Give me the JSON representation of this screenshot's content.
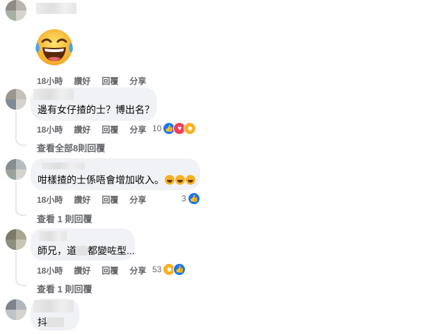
{
  "comments": [
    {
      "sticker": "haha-emoji",
      "actions": {
        "time": "18小時",
        "like": "讚好",
        "reply": "回覆",
        "share": "分享"
      }
    },
    {
      "text": "邊有女仔揸的士？博出名？",
      "actions": {
        "time": "18小時",
        "like": "讚好",
        "reply": "回覆",
        "share": "分享"
      },
      "reactions": {
        "count": "10",
        "icons": [
          "like-icon",
          "love-icon",
          "haha-icon"
        ]
      },
      "more_replies": "查看全部8則回覆"
    },
    {
      "text": "咁樣揸的士係唔會增加收入。",
      "actions": {
        "time": "18小時",
        "like": "讚好",
        "reply": "回覆",
        "share": "分享"
      },
      "reactions": {
        "count": "3",
        "icons": [
          "like-icon"
        ]
      },
      "more_replies": "查看 1 則回覆"
    },
    {
      "text_before": "師兄，道",
      "text_after": "都變咗型...",
      "actions": {
        "time": "18小時",
        "like": "讚好",
        "reply": "回覆",
        "share": "分享"
      },
      "reactions": {
        "count": "53",
        "icons": [
          "haha-icon",
          "like-icon"
        ]
      },
      "more_replies": "查看 1 則回覆"
    },
    {
      "text": "抖"
    }
  ],
  "colors": {
    "bubble": "#f0f2f5",
    "meta_text": "#65676b",
    "like_blue": "#1877f2",
    "love_red": "#f33e58",
    "haha_yellow": "#f7b125"
  }
}
